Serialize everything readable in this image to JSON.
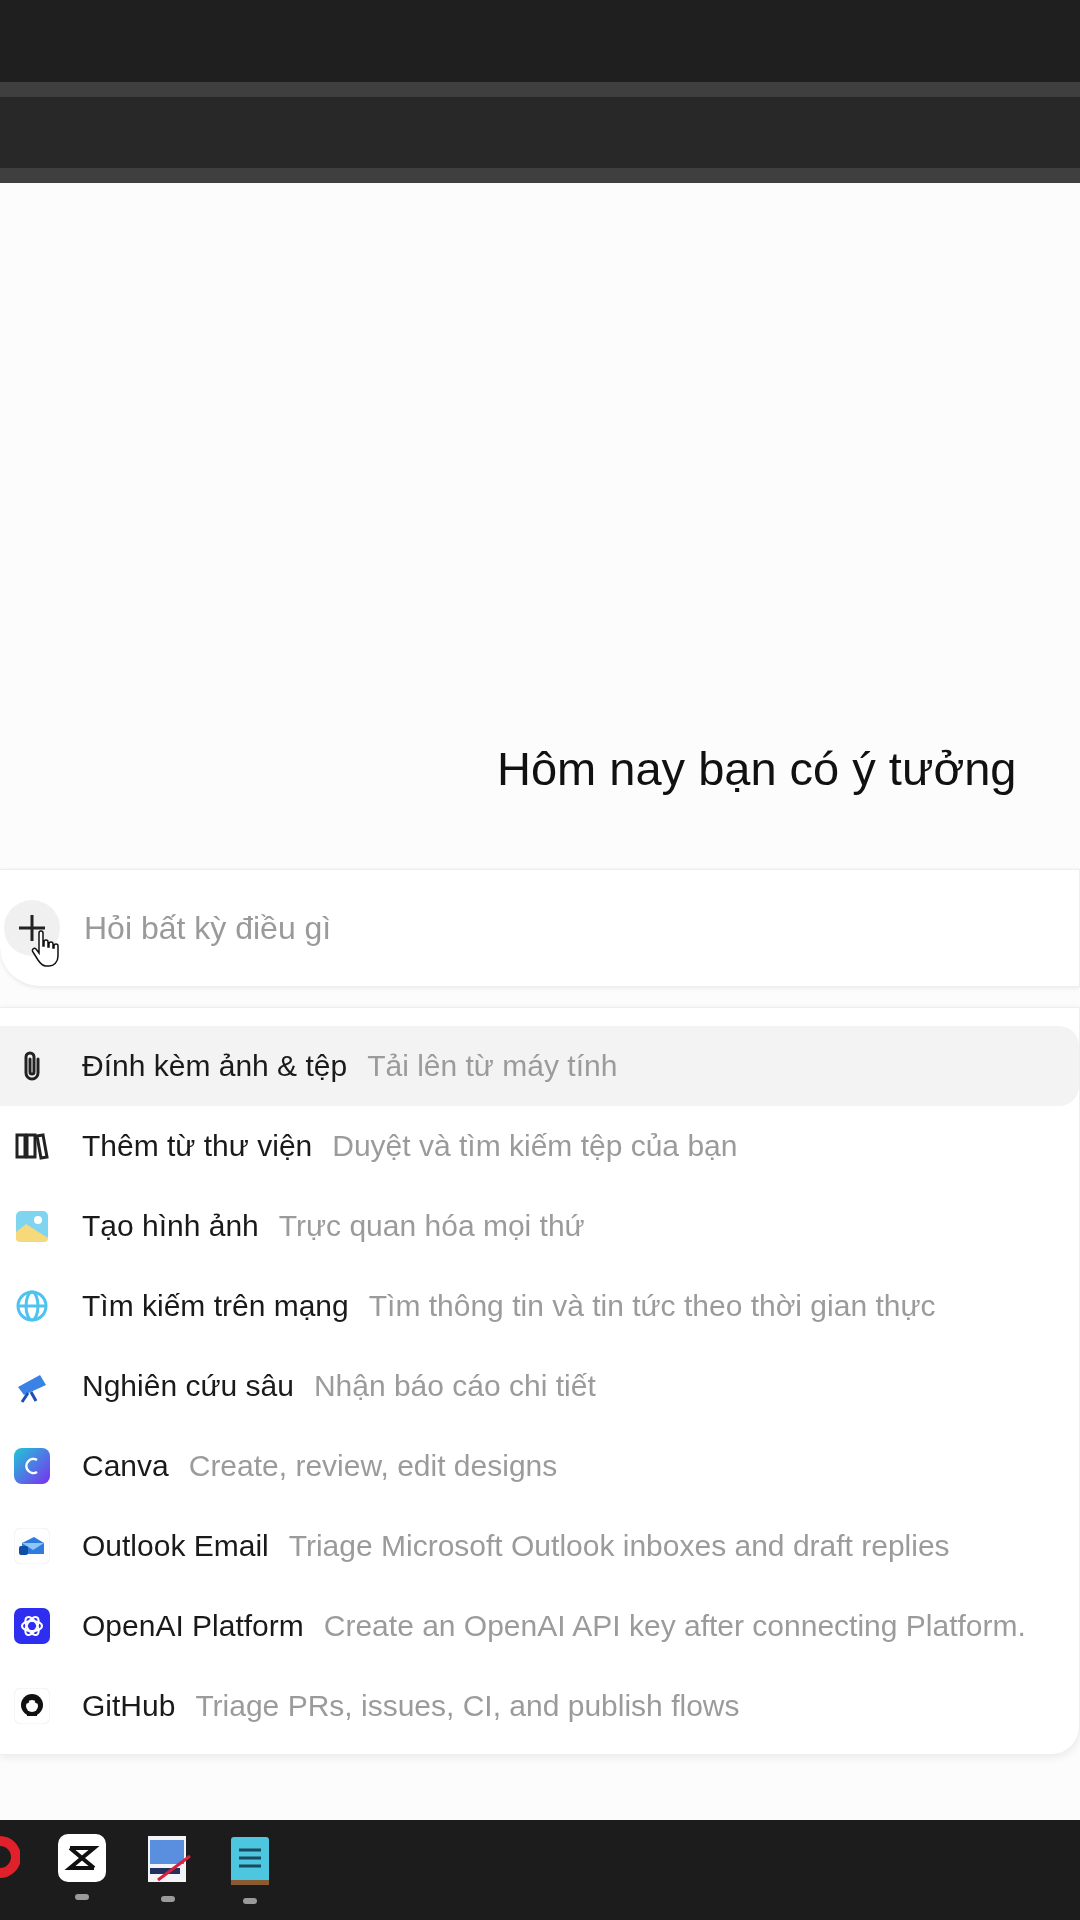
{
  "heading": "Hôm nay bạn có ý tưởng",
  "composer": {
    "placeholder": "Hỏi bất kỳ điều gì"
  },
  "menu": [
    {
      "title": "Đính kèm ảnh & tệp",
      "hint": "Tải lên từ máy tính",
      "selected": true
    },
    {
      "title": "Thêm từ thư viện",
      "hint": "Duyệt và tìm kiếm tệp của bạn",
      "selected": false
    },
    {
      "title": "Tạo hình ảnh",
      "hint": "Trực quan hóa mọi thứ",
      "selected": false
    },
    {
      "title": "Tìm kiếm trên mạng",
      "hint": "Tìm thông tin và tin tức theo thời gian thực",
      "selected": false
    },
    {
      "title": "Nghiên cứu sâu",
      "hint": "Nhận báo cáo chi tiết",
      "selected": false
    },
    {
      "title": "Canva",
      "hint": "Create, review, edit designs",
      "selected": false
    },
    {
      "title": "Outlook Email",
      "hint": "Triage Microsoft Outlook inboxes and draft replies",
      "selected": false
    },
    {
      "title": "OpenAI Platform",
      "hint": "Create an OpenAI API key after connecting Platform.",
      "selected": false
    },
    {
      "title": "GitHub",
      "hint": "Triage PRs, issues, CI, and publish flows",
      "selected": false
    }
  ]
}
